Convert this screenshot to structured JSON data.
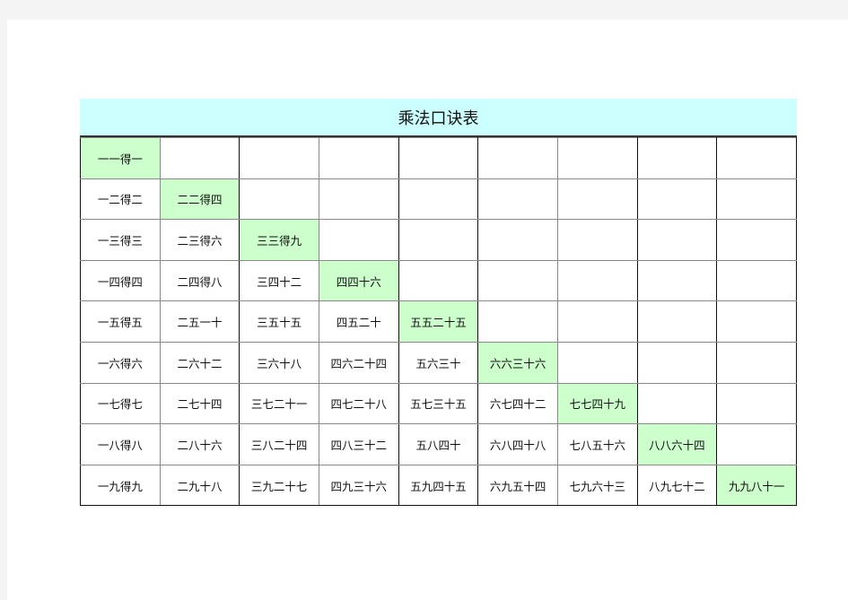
{
  "title": "乘法口诀表",
  "colors": {
    "title_bg": "#ccffff",
    "diagonal_bg": "#ccffcc"
  },
  "rows": [
    [
      "一一得一"
    ],
    [
      "一二得二",
      "二二得四"
    ],
    [
      "一三得三",
      "二三得六",
      "三三得九"
    ],
    [
      "一四得四",
      "二四得八",
      "三四十二",
      "四四十六"
    ],
    [
      "一五得五",
      "二五一十",
      "三五十五",
      "四五二十",
      "五五二十五"
    ],
    [
      "一六得六",
      "二六十二",
      "三六十八",
      "四六二十四",
      "五六三十",
      "六六三十六"
    ],
    [
      "一七得七",
      "二七十四",
      "三七二十一",
      "四七二十八",
      "五七三十五",
      "六七四十二",
      "七七四十九"
    ],
    [
      "一八得八",
      "二八十六",
      "三八二十四",
      "四八三十二",
      "五八四十",
      "六八四十八",
      "七八五十六",
      "八八六十四"
    ],
    [
      "一九得九",
      "二九十八",
      "三九二十七",
      "四九三十六",
      "五九四十五",
      "六九五十四",
      "七九六十三",
      "八九七十二",
      "九九八十一"
    ]
  ]
}
